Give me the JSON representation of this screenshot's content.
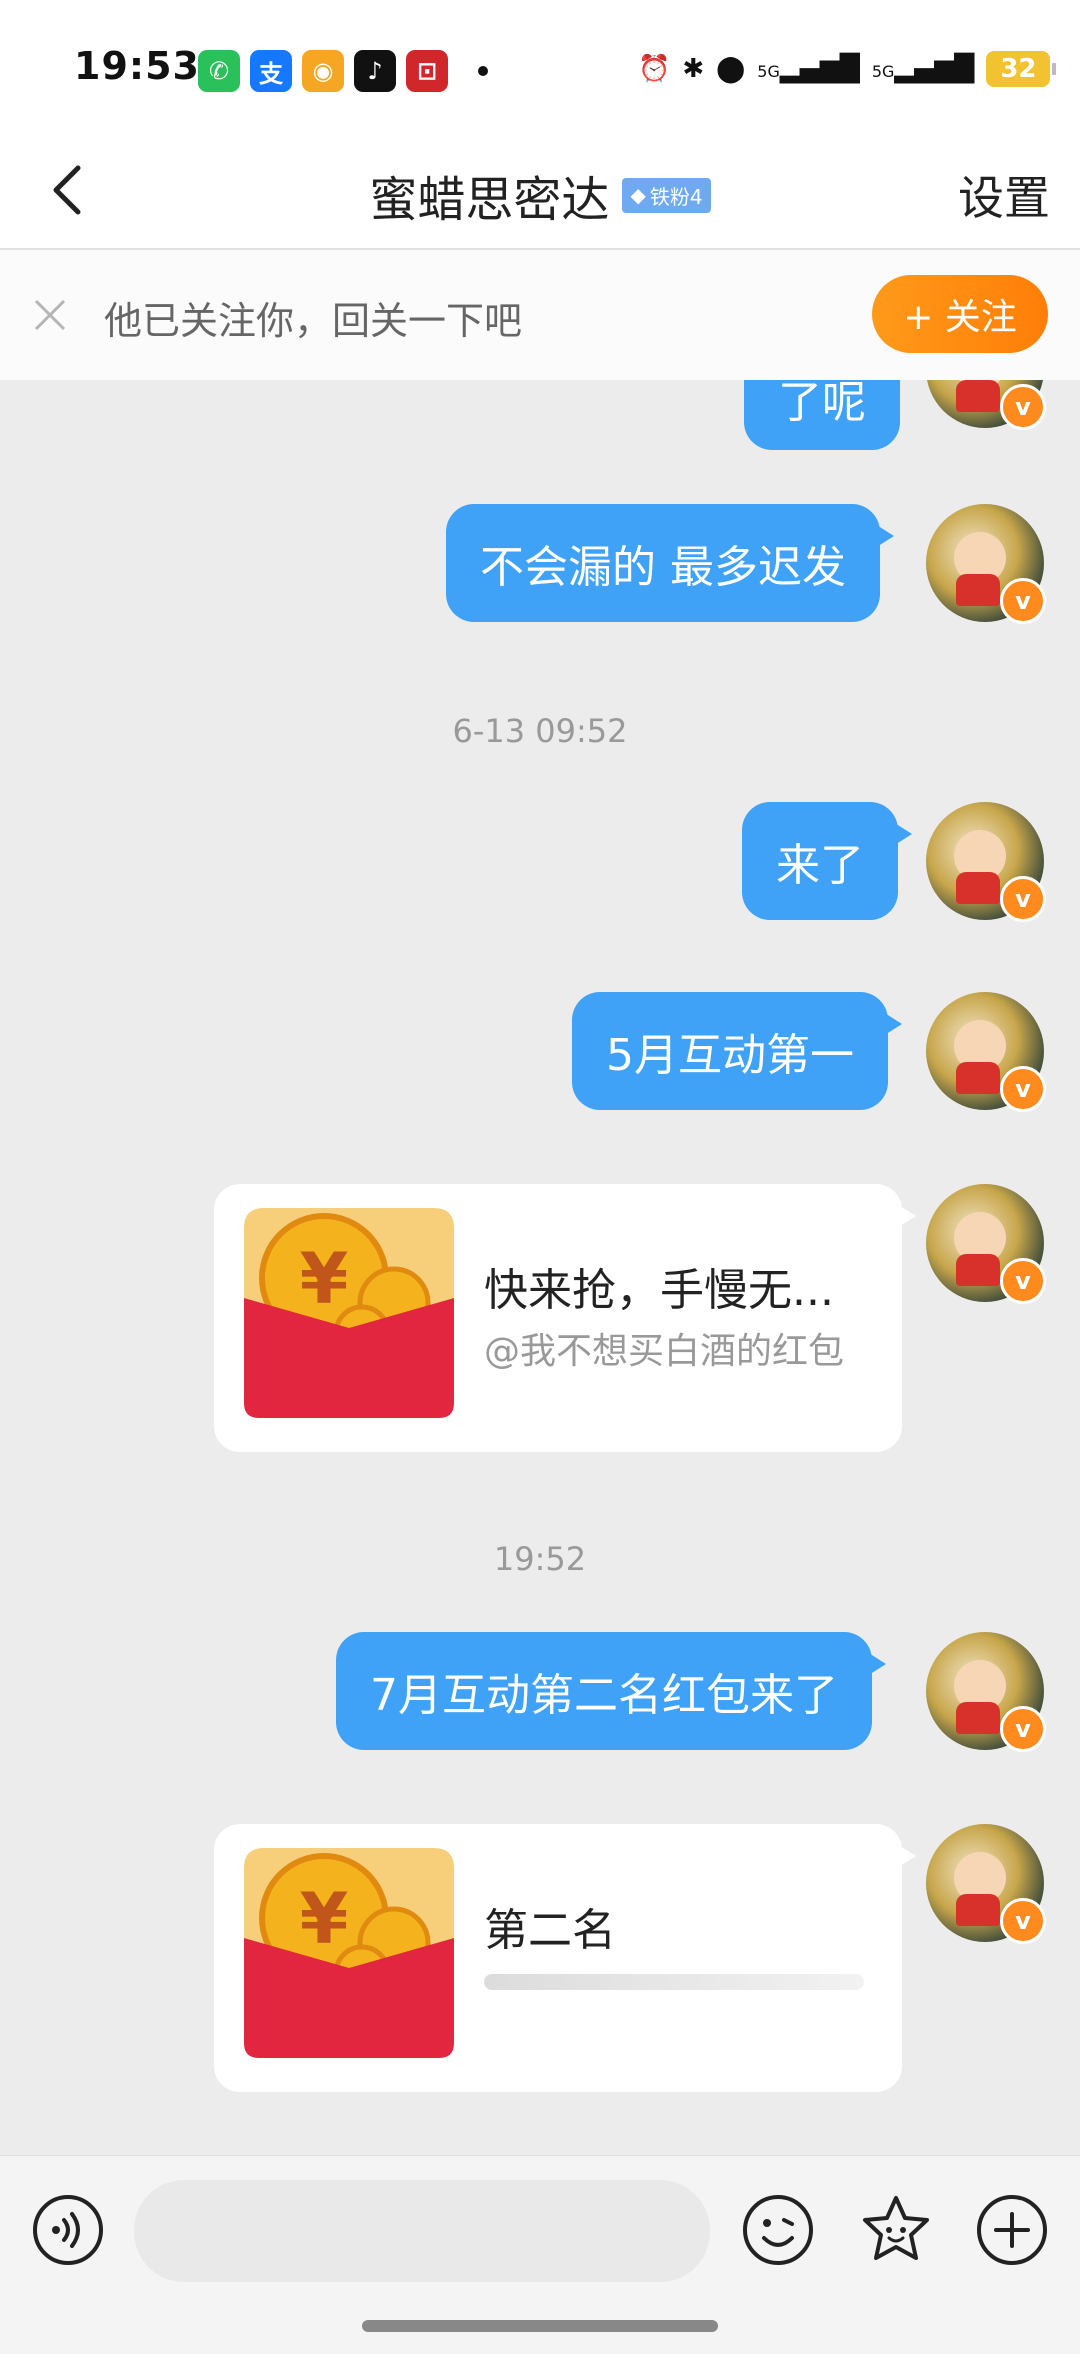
{
  "status_bar": {
    "time": "19:53",
    "app_icons": [
      {
        "name": "wechat-icon",
        "glyph": "✆",
        "color": "#2ac05a"
      },
      {
        "name": "alipay-icon",
        "glyph": "支",
        "color": "#1677ff"
      },
      {
        "name": "weibo-icon",
        "glyph": "◉",
        "color": "#f5a623"
      },
      {
        "name": "tiktok-icon",
        "glyph": "♪",
        "color": "#111111"
      },
      {
        "name": "bank-icon",
        "glyph": "⊡",
        "color": "#d0272a"
      }
    ],
    "signal_1": "5G",
    "signal_2": "5G",
    "battery": "32"
  },
  "header": {
    "title": "蜜蜡思密达",
    "fan_badge": "铁粉4",
    "settings_label": "设置"
  },
  "follow_banner": {
    "text": "他已关注你，回关一下吧",
    "button_label": "+ 关注"
  },
  "messages": {
    "partial_top": "了呢",
    "m1": "不会漏的 最多迟发",
    "ts1": "6-13 09:52",
    "m2": "来了",
    "m3": "5月互动第一",
    "red1_title": "快来抢，手慢无...",
    "red1_sub": "@我不想买白酒的红包",
    "ts2": "19:52",
    "m4": "7月互动第二名红包来了",
    "red2_title": "第二名"
  },
  "input_bar": {
    "placeholder": ""
  },
  "colors": {
    "bubble": "#3fa2f7",
    "follow_button": "#ff8a10",
    "chat_background": "#ececec"
  }
}
